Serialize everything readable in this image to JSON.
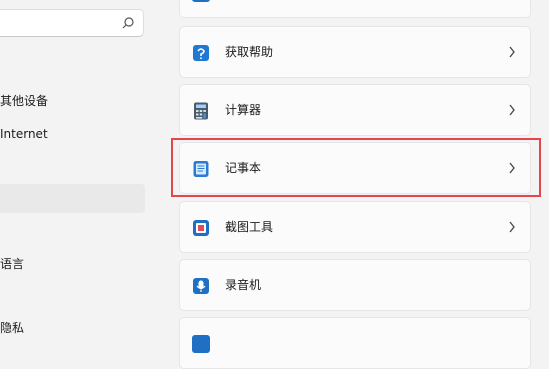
{
  "search": {
    "placeholder": ""
  },
  "sidebar": {
    "items": [
      {
        "label": "其他设备"
      },
      {
        "label": "Internet"
      },
      {
        "label": ""
      },
      {
        "label": "语言"
      },
      {
        "label": "隐私"
      }
    ]
  },
  "apps": [
    {
      "label": "",
      "icon": "app-icon"
    },
    {
      "label": "获取帮助",
      "icon": "help-icon"
    },
    {
      "label": "计算器",
      "icon": "calculator-icon"
    },
    {
      "label": "记事本",
      "icon": "notepad-icon"
    },
    {
      "label": "截图工具",
      "icon": "snipping-tool-icon"
    },
    {
      "label": "录音机",
      "icon": "voice-recorder-icon"
    },
    {
      "label": "",
      "icon": "app-icon"
    }
  ],
  "colors": {
    "highlight": "#e4474b",
    "accent": "#0067c0",
    "background": "#f3f3f3",
    "card": "#fbfbfb"
  }
}
